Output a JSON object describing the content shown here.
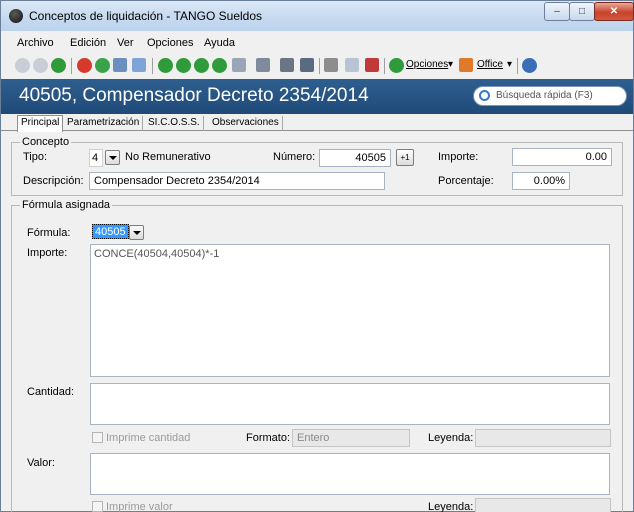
{
  "window": {
    "title": "Conceptos de liquidación - TANGO Sueldos"
  },
  "menu": [
    "Archivo",
    "Edición",
    "Ver",
    "Opciones",
    "Ayuda"
  ],
  "toolbar": {
    "opciones_label": "Opciones",
    "office_label": "Office"
  },
  "header": {
    "title": "40505, Compensador Decreto 2354/2014",
    "search_placeholder": "Búsqueda rápida (F3)"
  },
  "tabs": [
    "Principal",
    "Parametrización",
    "SI.C.O.S.S.",
    "Observaciones"
  ],
  "concepto": {
    "group_label": "Concepto",
    "tipo_label": "Tipo:",
    "tipo_value": "4",
    "tipo_text": "No Remunerativo",
    "numero_label": "Número:",
    "numero_value": "40505",
    "importe_label": "Importe:",
    "importe_value": "0.00",
    "descripcion_label": "Descripción:",
    "descripcion_value": "Compensador Decreto 2354/2014",
    "porcentaje_label": "Porcentaje:",
    "porcentaje_value": "0.00%"
  },
  "formula": {
    "group_label": "Fórmula asignada",
    "formula_label": "Fórmula:",
    "formula_value": "40505",
    "importe_label": "Importe:",
    "importe_value": "CONCE(40504,40504)*-1",
    "cantidad_label": "Cantidad:",
    "imprime_cantidad": "Imprime cantidad",
    "formato_label": "Formato:",
    "formato_value": "Entero",
    "leyenda_label": "Leyenda:",
    "valor_label": "Valor:",
    "imprime_valor": "Imprime valor",
    "leyenda2_label": "Leyenda:"
  }
}
